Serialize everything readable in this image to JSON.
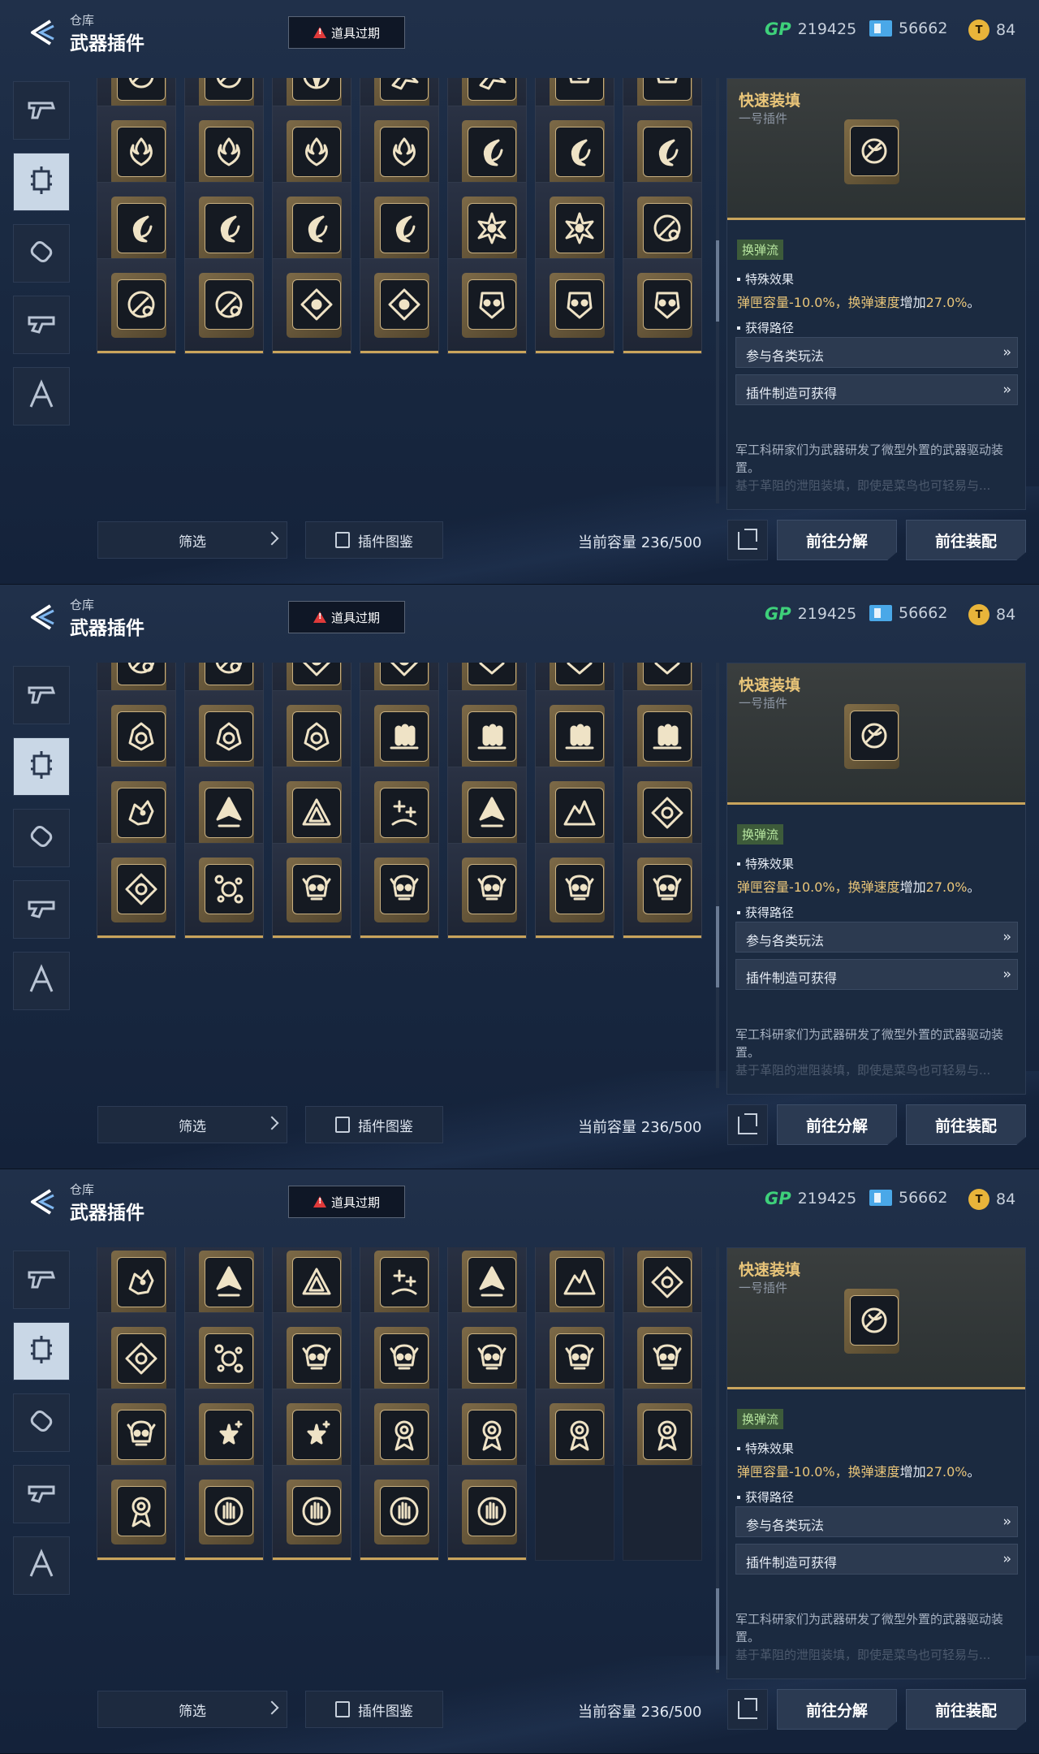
{
  "header": {
    "breadcrumb": "仓库",
    "title": "武器插件",
    "expire_label": "道具过期",
    "currency": {
      "gp_icon": "GP",
      "gp_value": "219425",
      "ticket_value": "56662",
      "coin_value": "84"
    }
  },
  "sidebar": {
    "items": [
      {
        "name": "weapon-pistol-icon"
      },
      {
        "name": "plugin-chip-icon",
        "active": true
      },
      {
        "name": "grenade-icon"
      },
      {
        "name": "rifle-part-icon"
      },
      {
        "name": "character-icon"
      }
    ]
  },
  "bottom": {
    "filter_label": "筛选",
    "guide_label": "插件图鉴",
    "capacity_label": "当前容量 236/500"
  },
  "panel": {
    "title": "快速装填",
    "subtitle": "一号插件",
    "tag": "换弹流",
    "effect_header": "特殊效果",
    "effect_a": "弹匣容量",
    "effect_a_val": "-10.0%",
    "effect_sep": "，",
    "effect_b": "换弹速度",
    "effect_b_verb": "增加",
    "effect_b_val": "27.0%",
    "effect_end": "。",
    "route_header": "获得路径",
    "route_1": "参与各类玩法",
    "route_2": "插件制造可获得",
    "desc": "军工科研家们为武器研发了微型外置的武器驱动装置。",
    "desc_faded": "基于革阻的泄阻装填，即使是菜鸟也可轻易与..."
  },
  "actions": {
    "decompose": "前往分解",
    "equip": "前往装配"
  },
  "screens": [
    {
      "rows": [
        [
          "swirl",
          "swirl",
          "compass",
          "burst",
          "burst",
          "crown",
          "crown"
        ],
        [
          "flame",
          "flame",
          "flame",
          "flame",
          "fire",
          "fire",
          "fire"
        ],
        [
          "fire",
          "fire",
          "fire",
          "fire",
          "star",
          "star",
          "bullet"
        ],
        [
          "bullet",
          "bullet",
          "diamond",
          "diamond",
          "mask",
          "mask",
          "mask"
        ]
      ]
    },
    {
      "rows": [
        [
          "bullet",
          "bullet",
          "diamond",
          "diamond",
          "mask",
          "mask",
          "mask"
        ],
        [
          "helm",
          "helm",
          "helm",
          "ammo",
          "ammo",
          "ammo",
          "ammo"
        ],
        [
          "beast",
          "arrow",
          "tri",
          "plus",
          "arrow",
          "peak",
          "eye"
        ],
        [
          "eye",
          "gears",
          "skull",
          "skull",
          "skull",
          "skull",
          "skull"
        ]
      ]
    },
    {
      "rows": [
        [
          "beast",
          "arrow",
          "tri",
          "plus",
          "arrow",
          "peak",
          "eye"
        ],
        [
          "eye",
          "gears",
          "skull",
          "skull",
          "skull",
          "skull",
          "skull"
        ],
        [
          "skull",
          "spark",
          "spark",
          "medal",
          "medal",
          "medal",
          "medal"
        ],
        [
          "medal",
          "hand",
          "hand",
          "hand",
          "hand",
          "",
          ""
        ]
      ]
    }
  ]
}
